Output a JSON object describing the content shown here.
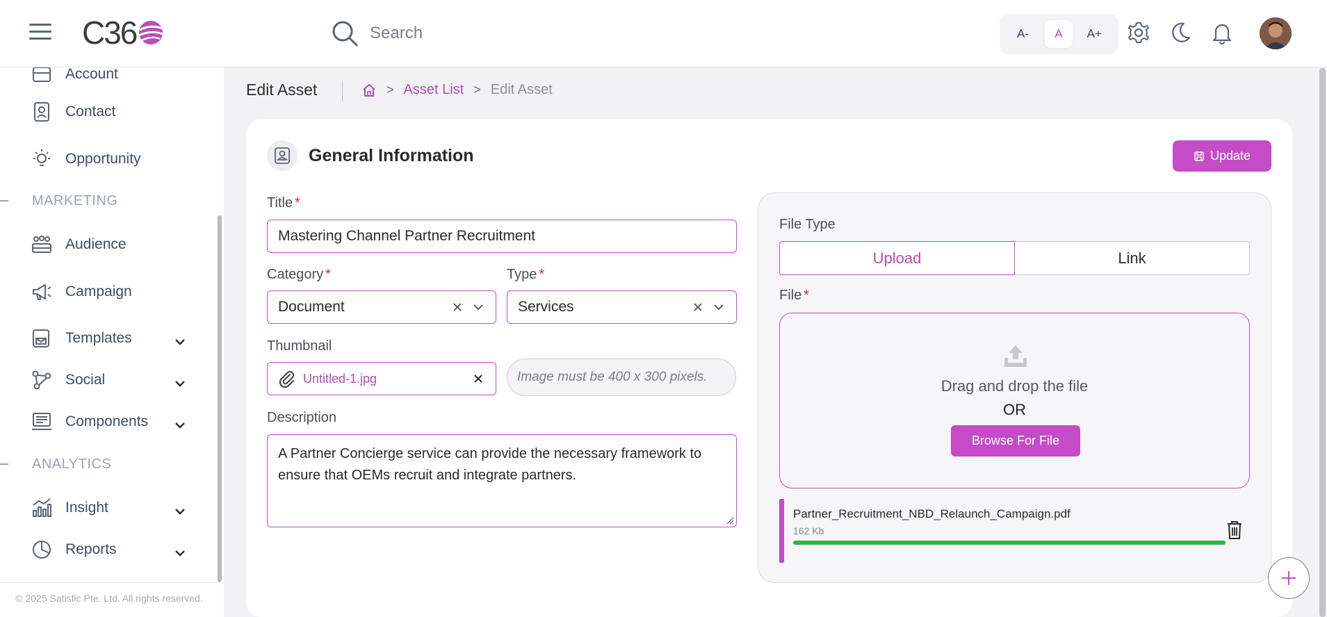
{
  "header": {
    "logo_text": "C36",
    "search_placeholder": "Search",
    "font_decrease": "A-",
    "font_default": "A",
    "font_increase": "A+"
  },
  "sidebar": {
    "items_top": [
      {
        "label": "Account",
        "icon": "account-icon"
      },
      {
        "label": "Contact",
        "icon": "contact-icon"
      },
      {
        "label": "Opportunity",
        "icon": "lightbulb-icon"
      }
    ],
    "section_marketing": "MARKETING",
    "marketing_items": [
      {
        "label": "Audience",
        "icon": "audience-icon"
      },
      {
        "label": "Campaign",
        "icon": "megaphone-icon"
      },
      {
        "label": "Templates",
        "icon": "templates-icon"
      },
      {
        "label": "Social",
        "icon": "social-icon"
      },
      {
        "label": "Components",
        "icon": "components-icon"
      }
    ],
    "section_analytics": "ANALYTICS",
    "analytics_items": [
      {
        "label": "Insight",
        "icon": "insight-icon"
      },
      {
        "label": "Reports",
        "icon": "pie-chart-icon"
      }
    ],
    "footer": "© 2025 Satisfic Pte. Ltd. All rights reserved."
  },
  "breadcrumb": {
    "page_title": "Edit Asset",
    "home_icon": "home-icon",
    "link": "Asset List",
    "current": "Edit Asset"
  },
  "form": {
    "section_title": "General Information",
    "update_label": "Update",
    "title_label": "Title",
    "title_value": "Mastering Channel Partner Recruitment",
    "category_label": "Category",
    "category_value": "Document",
    "type_label": "Type",
    "type_value": "Services",
    "thumbnail_label": "Thumbnail",
    "thumbnail_file": "Untitled-1.jpg",
    "thumbnail_hint": "Image must be 400 x 300 pixels.",
    "description_label": "Description",
    "description_value": "A Partner Concierge service can provide the necessary framework to ensure that OEMs recruit and integrate partners.",
    "required_mark": "*"
  },
  "file_panel": {
    "file_type_label": "File Type",
    "upload_label": "Upload",
    "link_label": "Link",
    "file_label": "File",
    "drag_text": "Drag and drop the file",
    "or_text": "OR",
    "browse_label": "Browse For File",
    "uploaded_name": "Partner_Recruitment_NBD_Relaunch_Campaign.pdf",
    "uploaded_size": "162 Kb",
    "upload_progress": 1.0
  },
  "colors": {
    "accent": "#c54bc7",
    "progress": "#33b24a",
    "required": "#e0223b"
  }
}
